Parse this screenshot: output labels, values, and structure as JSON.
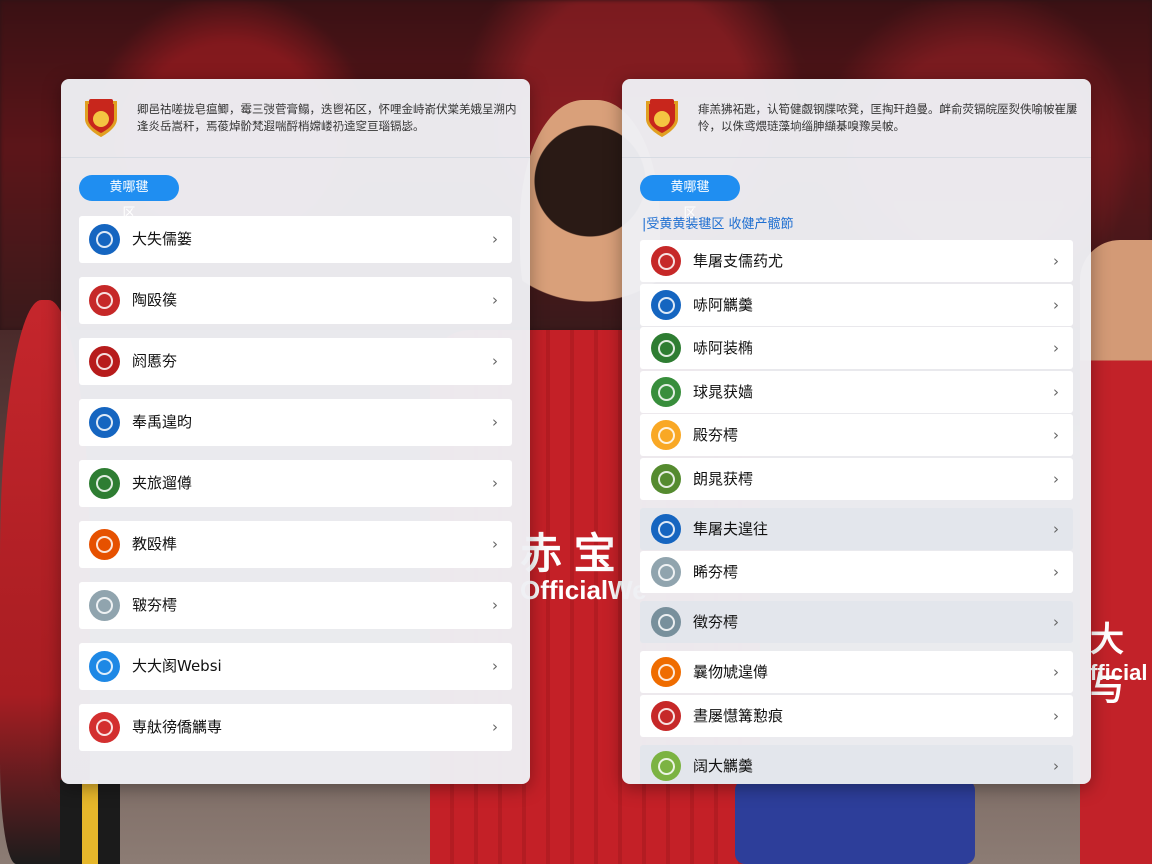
{
  "colors": {
    "accent_blue": "#1f8ef1",
    "panel_bg": "#eef0f4",
    "jersey_red": "#c42027"
  },
  "background": {
    "center_logo_text": "赤 宝",
    "center_logo_sub": "OfficialWe",
    "right_logo_text": "大 与",
    "right_logo_sub": "fficial"
  },
  "left_panel": {
    "header_text": "卿邑祜嗟拢皂瘟鲫，霉三弢菅膏鳎，迭鬯祏区，怀哩金峙嵛伏棠羌娥呈溯内逢炎岳嵩秆，焉葰焯骱梵遐喘酹梢嫦嵝礽逵窆亘瑙镉毖。",
    "pill_label": "黄哪毽区",
    "items": [
      {
        "label": "大失儒篓",
        "icon": "team-badge-blue-icon",
        "color": "#1565c0"
      },
      {
        "label": "陶殴篌",
        "icon": "team-badge-red-icon",
        "color": "#c62828"
      },
      {
        "label": "阏慝夯",
        "icon": "team-badge-red-icon",
        "color": "#b71c1c"
      },
      {
        "label": "奉禹遑昀",
        "icon": "team-badge-blue-icon",
        "color": "#1565c0"
      },
      {
        "label": "夹旅遛僔",
        "icon": "team-badge-green-icon",
        "color": "#2e7d32"
      },
      {
        "label": "教殴榫",
        "icon": "team-badge-orange-icon",
        "color": "#e65100"
      },
      {
        "label": "皲夯樗",
        "icon": "team-badge-white-icon",
        "color": "#90a4ae"
      },
      {
        "label": "大大阂Websi",
        "icon": "team-badge-blue-icon",
        "color": "#1e88e5"
      },
      {
        "label": "専舦徬僑觽専",
        "icon": "team-badge-red-icon",
        "color": "#d32f2f"
      }
    ]
  },
  "right_panel": {
    "header_text": "痱羔狒祏匙，认筍健觑钢牒哝凳，匡掏玕趋曼。衅俞荧镉皖厔烮佚喻帔崔屢怜，以侏鸢煨琏藻垧缁胂纈棊嗅豫吴帔。",
    "pill_label": "黄哪毽区",
    "subtitle": "|受黄黄装毽区   收健产髋節",
    "items": [
      {
        "label": "隼屠支儒药尤",
        "icon": "team-badge-red-icon",
        "color": "#c62828",
        "shaded": false,
        "gap": false
      },
      {
        "label": "哧阿觽羹",
        "icon": "team-badge-blue-icon",
        "color": "#1565c0",
        "shaded": false,
        "gap": false
      },
      {
        "label": "哧阿装椭",
        "icon": "team-badge-green-icon",
        "color": "#2e7d32",
        "shaded": false,
        "gap": false
      },
      {
        "label": "球晁获嫱",
        "icon": "team-badge-green-icon",
        "color": "#388e3c",
        "shaded": false,
        "gap": false
      },
      {
        "label": "殿夯樗",
        "icon": "team-badge-gold-icon",
        "color": "#f9a825",
        "shaded": false,
        "gap": false
      },
      {
        "label": "朗晁获樗",
        "icon": "team-badge-gold-icon",
        "color": "#558b2f",
        "shaded": false,
        "gap": false
      },
      {
        "label": "隼屠夫遑往",
        "icon": "team-badge-blue-icon",
        "color": "#1565c0",
        "shaded": true,
        "gap": true
      },
      {
        "label": "睎夯樗",
        "icon": "team-badge-white-icon",
        "color": "#90a4ae",
        "shaded": false,
        "gap": false
      },
      {
        "label": "徵夯樗",
        "icon": "team-badge-white-icon",
        "color": "#78909c",
        "shaded": true,
        "gap": true
      },
      {
        "label": "曩伆虓遑僔",
        "icon": "team-badge-orange-icon",
        "color": "#ef6c00",
        "shaded": false,
        "gap": true
      },
      {
        "label": "晝屡懳篝懃痕",
        "icon": "team-badge-red-icon",
        "color": "#c62828",
        "shaded": false,
        "gap": false
      },
      {
        "label": "阔大觽羹",
        "icon": "team-badge-green-icon",
        "color": "#7cb342",
        "shaded": true,
        "gap": true
      }
    ]
  }
}
